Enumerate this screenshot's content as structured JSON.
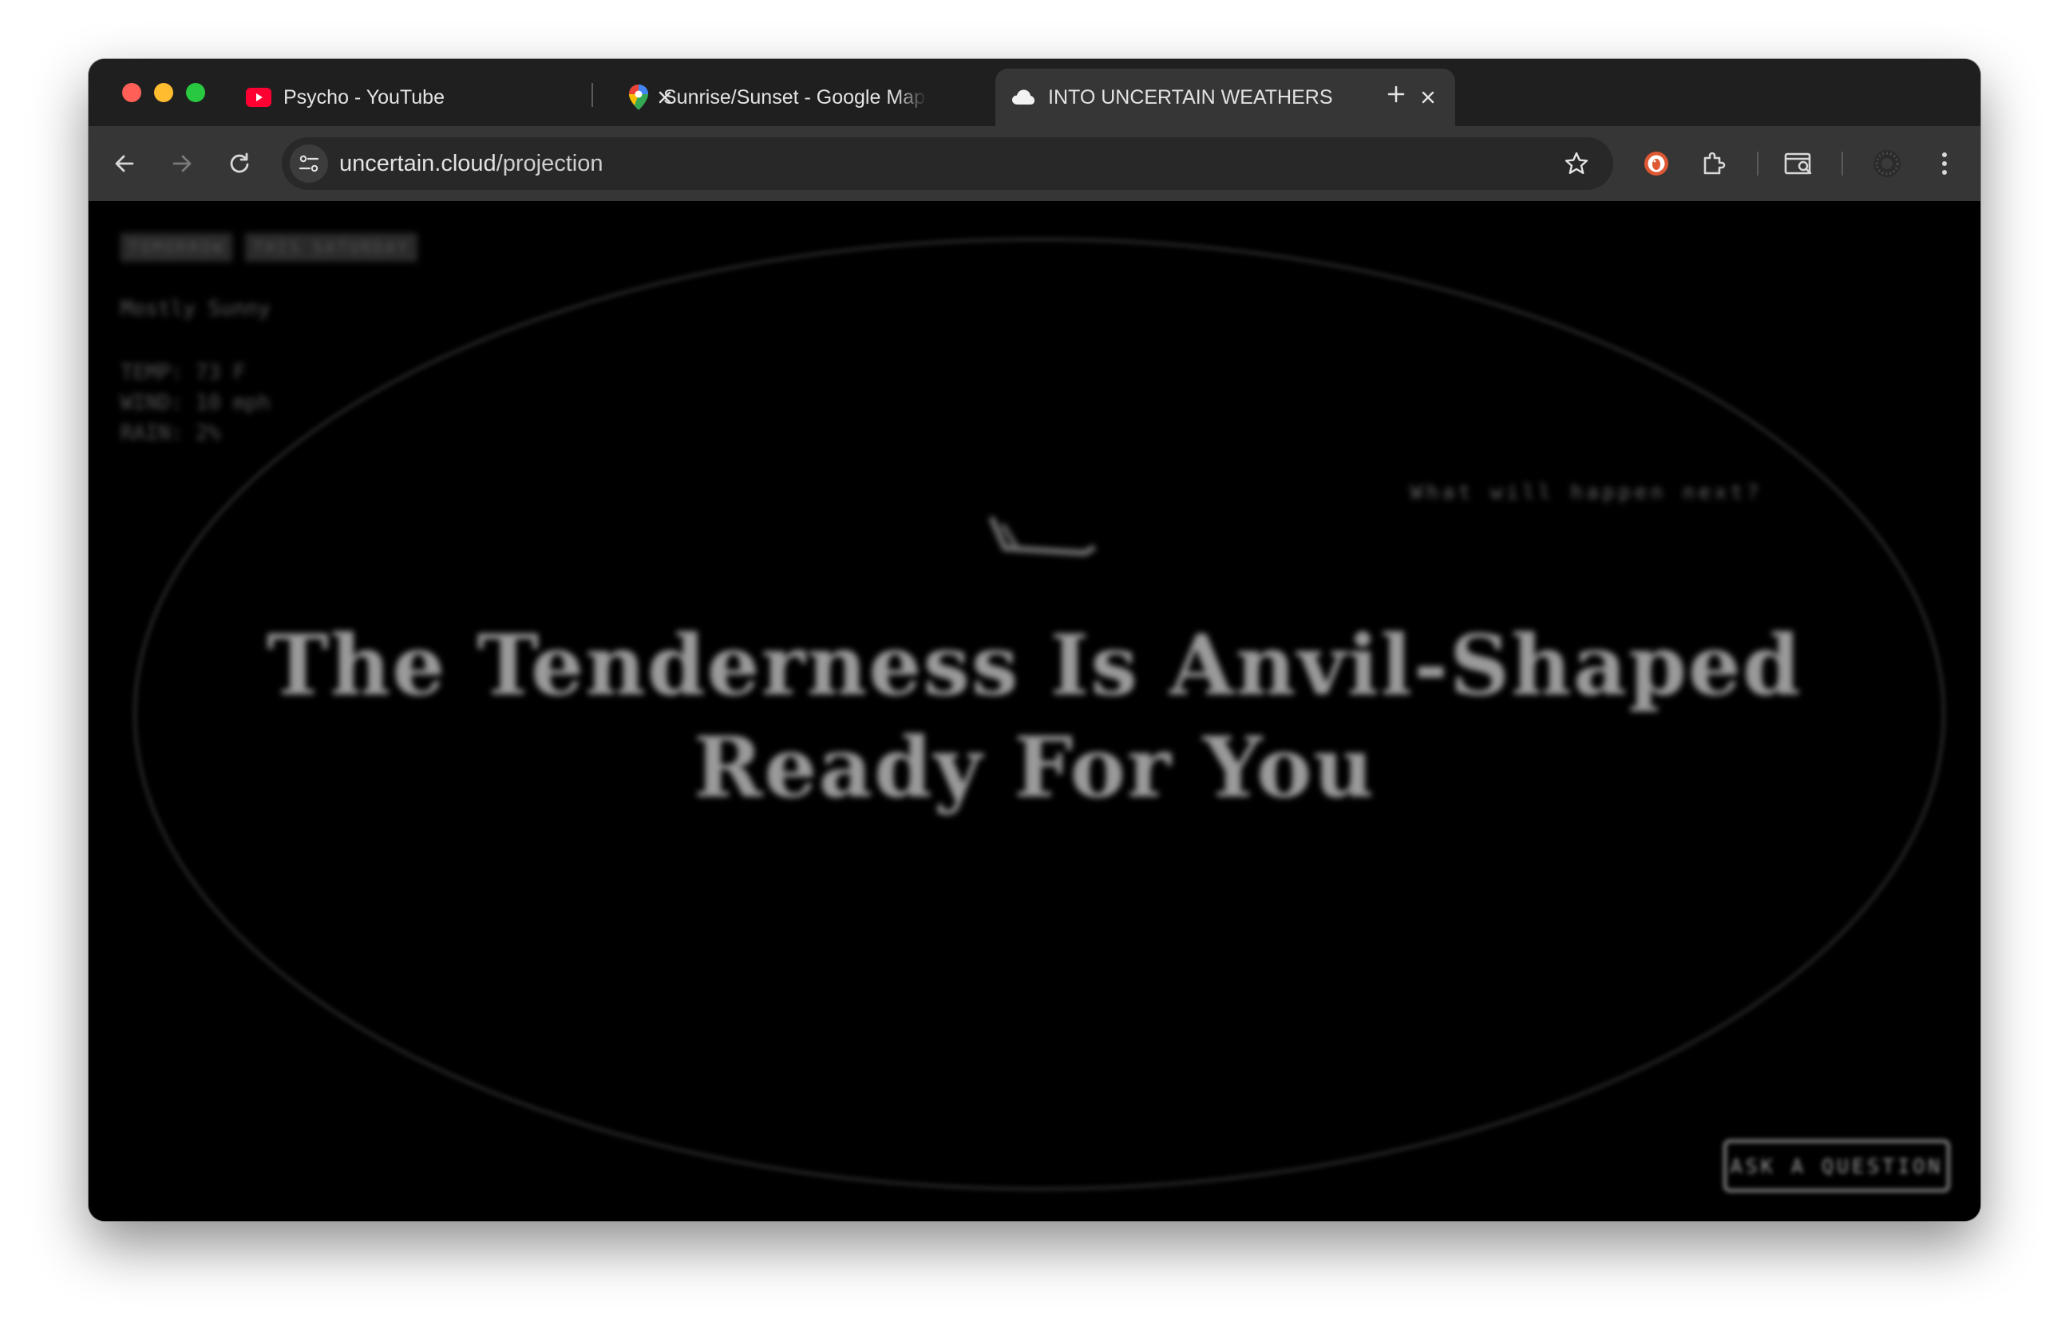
{
  "browser": {
    "tabs": [
      {
        "title": "Psycho - YouTube",
        "icon": "youtube-icon",
        "active": false
      },
      {
        "title": "Sunrise/Sunset - Google Maps",
        "icon": "google-maps-pin-icon",
        "active": false
      },
      {
        "title": "INTO UNCERTAIN WEATHERS",
        "icon": "cloud-icon",
        "active": true
      }
    ],
    "address": {
      "domain": "uncertain.cloud",
      "path": "/projection"
    }
  },
  "page": {
    "chips": [
      "TOMORROW",
      "THIS SATURDAY"
    ],
    "condition": "Mostly Sunny",
    "stats": [
      "TEMP: 73 F",
      "WIND: 10 mph",
      "RAIN: 2%"
    ],
    "prompt": "What will happen next?",
    "headline_line1": "The Tenderness Is Anvil-Shaped",
    "headline_line2": "Ready For You",
    "ask_button": "ASK A QUESTION"
  },
  "colors": {
    "tabbar": "#1f1f1f",
    "toolbar": "#363636",
    "page_background": "#000000",
    "headline": "#9a9a9a"
  }
}
